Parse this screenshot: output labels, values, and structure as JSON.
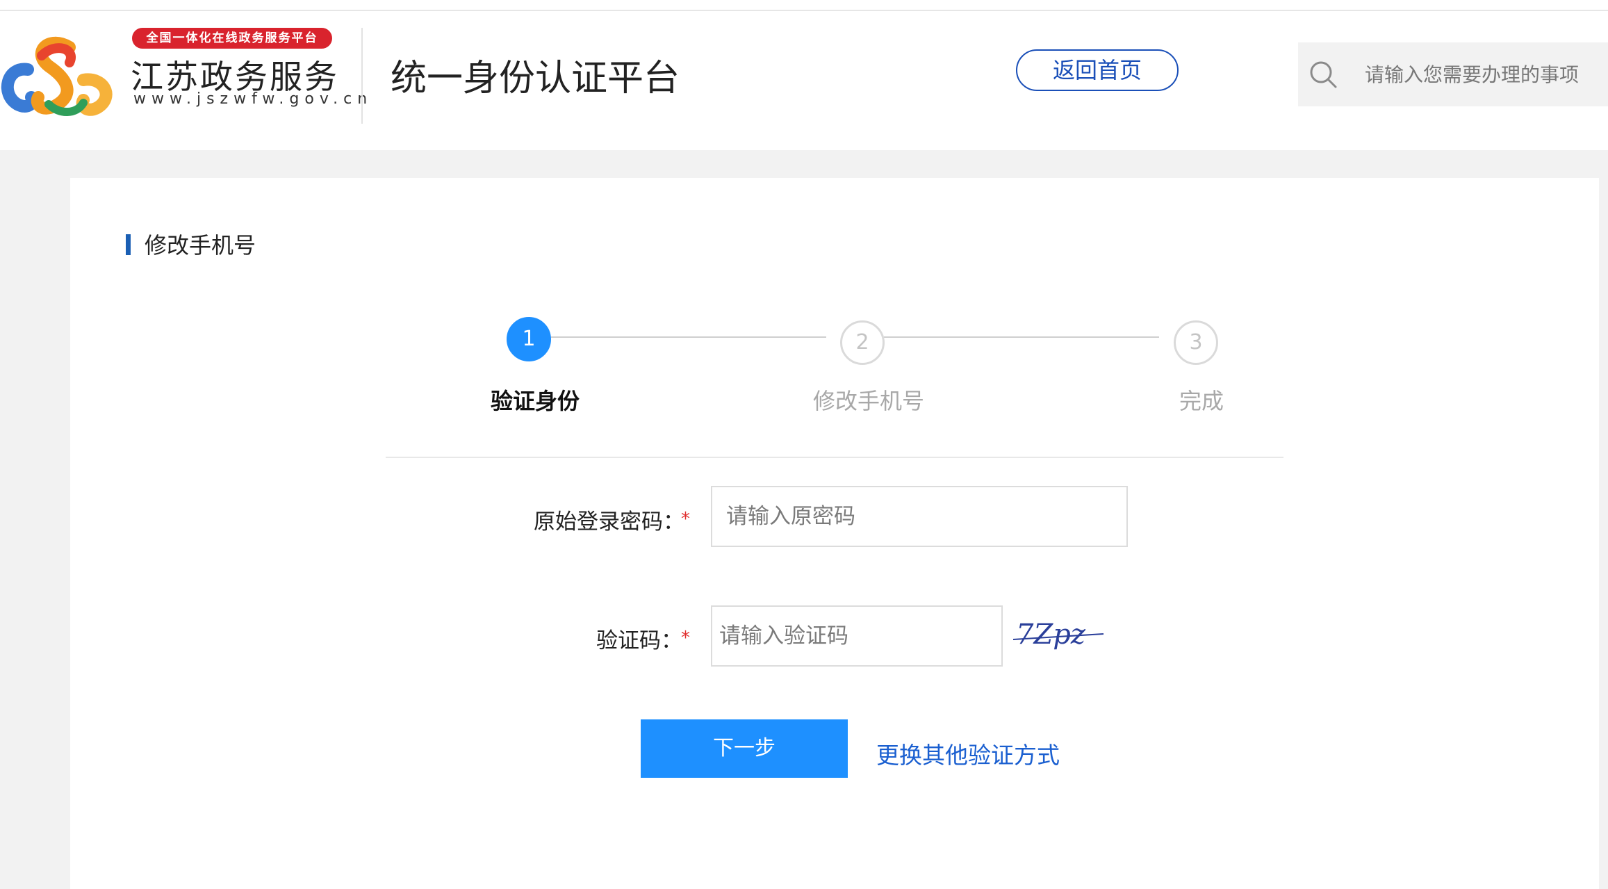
{
  "header": {
    "logo_badge": "全国一体化在线政务服务平台",
    "logo_name": "江苏政务服务",
    "logo_url": "www.jszwfw.gov.cn",
    "platform_title": "统一身份认证平台",
    "home_button": "返回首页",
    "search_placeholder": "请输入您需要办理的事项"
  },
  "section": {
    "title": "修改手机号"
  },
  "steps": [
    {
      "number": "1",
      "label": "验证身份",
      "state": "active"
    },
    {
      "number": "2",
      "label": "修改手机号",
      "state": "pending"
    },
    {
      "number": "3",
      "label": "完成",
      "state": "pending"
    }
  ],
  "form": {
    "password_label": "原始登录密码：",
    "password_placeholder": "请输入原密码",
    "captcha_label": "验证码：",
    "captcha_placeholder": "请输入验证码",
    "required_mark": "*",
    "captcha_text": "7Zpz",
    "next_button": "下一步",
    "switch_link": "更换其他验证方式"
  },
  "colors": {
    "accent": "#1e90ff",
    "link": "#1a5fd0",
    "badge": "#d9232d",
    "required": "#e03030"
  }
}
